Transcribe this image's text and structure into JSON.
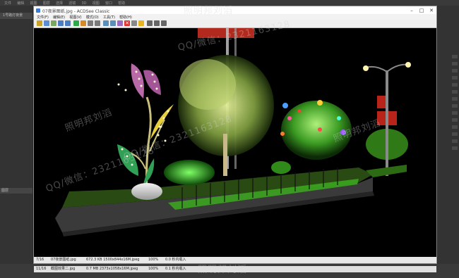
{
  "viewer": {
    "title": "07夜景图纸.jpg - ACDSee Classic",
    "menus": [
      "文件(F)",
      "编辑(E)",
      "视图(V)",
      "模式(O)",
      "工具(T)",
      "帮助(H)"
    ],
    "status": {
      "index": "7/16",
      "file": "07夜景图纸.jpg",
      "size": "672.3 KB 1500x844x16M.jpeg",
      "zoom": "100%",
      "loaded": "0.0 秒内载入"
    }
  },
  "bg_status": {
    "index": "11/16",
    "file": "截图效果二.jpg",
    "size": "0.7 MB 2373x1058x16M.jpeg",
    "zoom": "100%",
    "loaded": "0.1 秒内载入"
  },
  "bg_app": {
    "menus": [
      "文件",
      "编辑",
      "视图",
      "图层",
      "选择",
      "滤镜",
      "3D",
      "视图",
      "窗口",
      "帮助"
    ],
    "left_title": "1号路灯夜景",
    "left_bottom": "图层"
  },
  "watermark": {
    "name": "照明邦刘滔",
    "contact": "QQ/微信：2321163128"
  }
}
